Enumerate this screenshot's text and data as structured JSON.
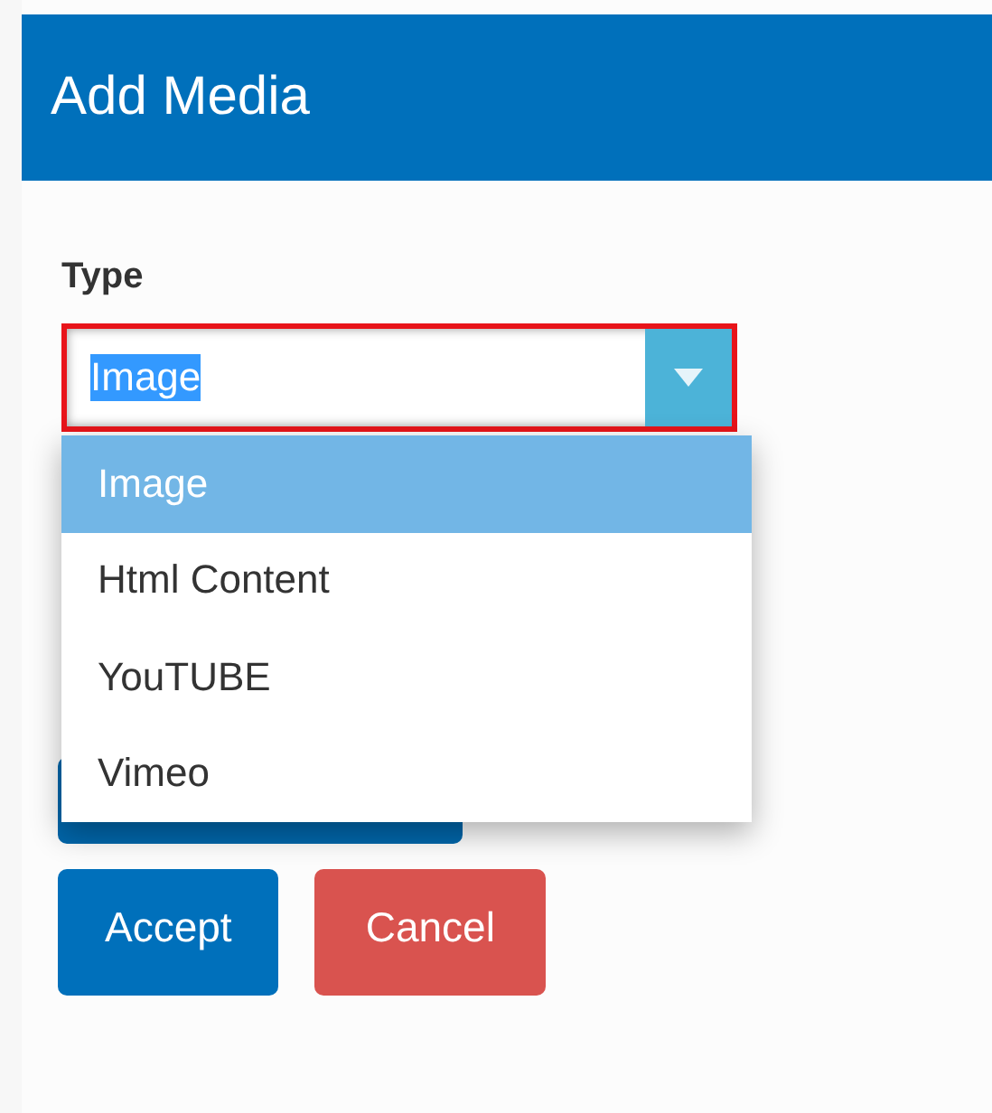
{
  "dialog": {
    "title": "Add Media"
  },
  "type_field": {
    "label": "Type",
    "value": "Image",
    "expanded": true,
    "options": [
      {
        "label": "Image",
        "selected": true
      },
      {
        "label": "Html Content",
        "selected": false
      },
      {
        "label": "YouTUBE",
        "selected": false
      },
      {
        "label": "Vimeo",
        "selected": false
      }
    ]
  },
  "buttons": [
    {
      "label": "Accept",
      "kind": "primary"
    },
    {
      "label": "Cancel",
      "kind": "danger"
    }
  ]
}
